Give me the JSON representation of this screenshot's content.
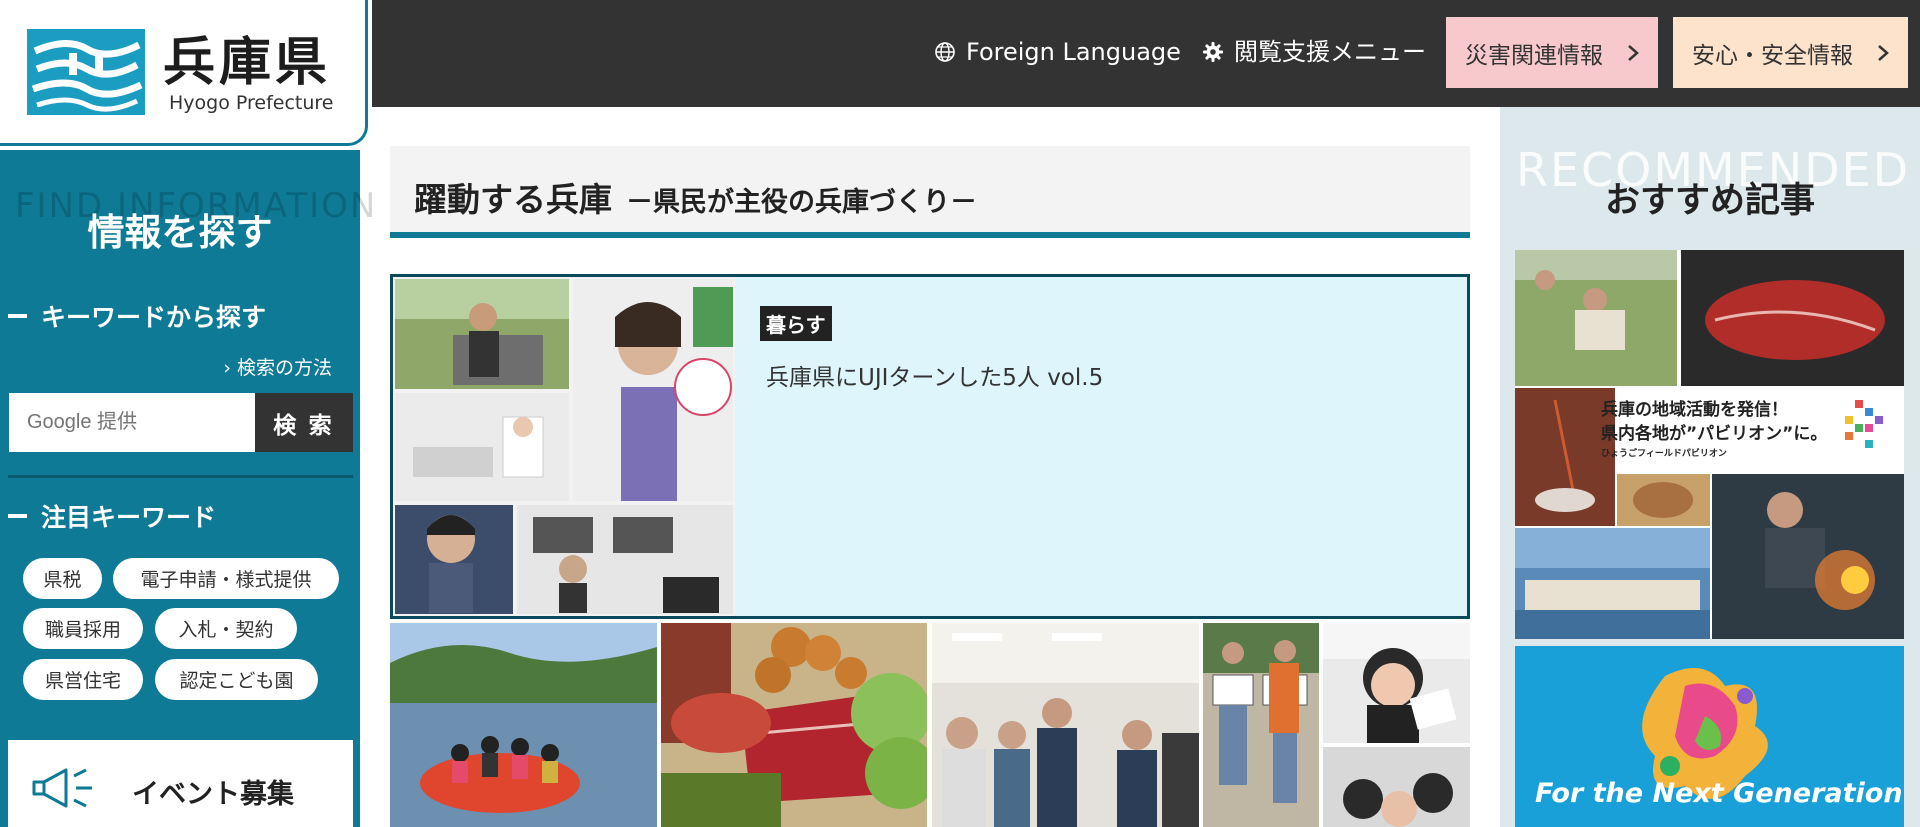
{
  "header": {
    "foreign_language": "Foreign Language",
    "accessibility_menu": "閲覧支援メニュー",
    "disaster_info": "災害関連情報",
    "safety_info": "安心・安全情報",
    "colors": {
      "bar": "#333333",
      "disaster_bg": "#f7c9cc",
      "safety_bg": "#fde3cc"
    },
    "icons": {
      "globe": "globe-icon",
      "gear": "gear-icon",
      "chevron": "chevron-right-icon"
    }
  },
  "logo": {
    "jp": "兵庫県",
    "en": "Hyogo Prefecture"
  },
  "sidebar": {
    "heading_en": "FIND INFORMATION",
    "heading_jp": "情報を探す",
    "keyword_section": "キーワードから探す",
    "how_to_search": "検索の方法",
    "search_placeholder": "Google 提供",
    "search_button": "検 索",
    "featured_section": "注目キーワード",
    "chips": [
      "県税",
      "電子申請・様式提供",
      "職員採用",
      "入札・契約",
      "県営住宅",
      "認定こども園"
    ],
    "event_label": "イベント募集",
    "accent": "#0e7a96"
  },
  "main": {
    "title": "躍動する兵庫",
    "subtitle": "－県民が主役の兵庫づくり－",
    "feature": {
      "tag": "暮らす",
      "title": "兵庫県にUJIターンした5人 vol.5"
    }
  },
  "recommended": {
    "heading_en": "RECOMMENDED",
    "heading_jp": "おすすめ記事",
    "banner_line1": "兵庫の地域活動を発信！",
    "banner_line2": "県内各地が”パビリオン”に。",
    "banner_small": "ひょうごフィールドパビリオン",
    "banner2_text": "For the Next Generation"
  }
}
